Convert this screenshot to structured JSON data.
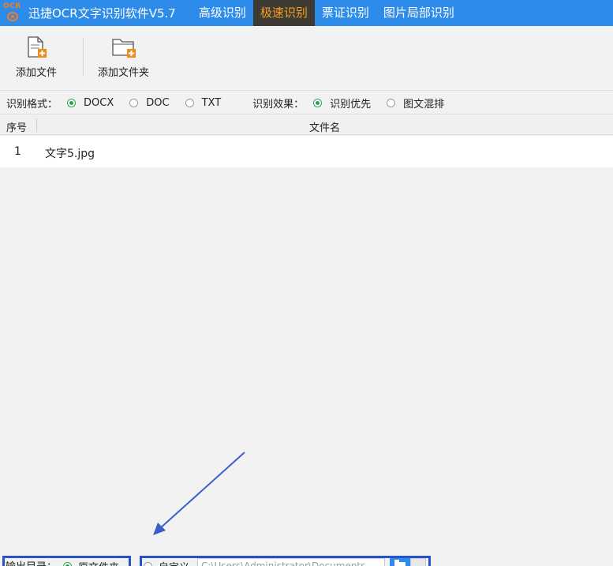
{
  "app": {
    "logo_text": "OCR",
    "title": "迅捷OCR文字识别软件V5.7"
  },
  "menu": {
    "tabs": [
      {
        "label": "高级识别",
        "active": false
      },
      {
        "label": "极速识别",
        "active": true
      },
      {
        "label": "票证识别",
        "active": false
      },
      {
        "label": "图片局部识别",
        "active": false
      }
    ]
  },
  "toolbar": {
    "add_file": "添加文件",
    "add_folder": "添加文件夹"
  },
  "options": {
    "format_label": "识别格式：",
    "formats": [
      {
        "label": "DOCX",
        "selected": true
      },
      {
        "label": "DOC",
        "selected": false
      },
      {
        "label": "TXT",
        "selected": false
      }
    ],
    "effect_label": "识别效果：",
    "effects": [
      {
        "label": "识别优先",
        "selected": true
      },
      {
        "label": "图文混排",
        "selected": false
      }
    ]
  },
  "table": {
    "columns": [
      "序号",
      "文件名"
    ],
    "rows": [
      {
        "index": "1",
        "filename": "文字5.jpg"
      }
    ]
  },
  "output": {
    "label": "输出目录：",
    "original_folder": "原文件夹",
    "original_selected": true,
    "custom": "自定义",
    "custom_selected": false,
    "path_value": "C:\\Users\\Administrator\\Documents"
  },
  "colors": {
    "menu_bar": "#2d8cea",
    "active_tab_bg": "#3e3a34",
    "active_tab_text": "#f5a020",
    "radio_selected": "#2ca24a",
    "highlight_box": "#2a52c8"
  }
}
